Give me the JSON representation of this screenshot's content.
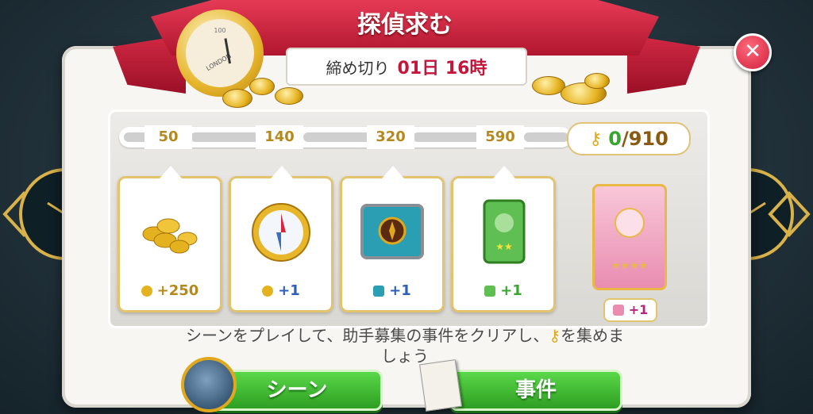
{
  "header": {
    "title": "探偵求む",
    "deadline_label": "締め切り",
    "deadline_value": "01日 16時",
    "stopwatch_text": "LONDON",
    "stopwatch_number": "100",
    "close_label": "✕"
  },
  "progress": {
    "milestones": [
      "50",
      "140",
      "320",
      "590"
    ],
    "current": "0",
    "total": "/910"
  },
  "rewards": [
    {
      "amount": "+250",
      "type": "coins"
    },
    {
      "amount": "+1",
      "type": "compass"
    },
    {
      "amount": "+1",
      "type": "chest"
    },
    {
      "amount": "+1",
      "type": "green-card"
    }
  ],
  "final_reward": {
    "amount": "+1",
    "type": "pink-card"
  },
  "instruction": {
    "line1": "シーンをプレイして、助手募集の事件をクリアし、",
    "line1b": "を集めま",
    "line2": "しょう"
  },
  "buttons": {
    "scene": "シーン",
    "case": "事件"
  },
  "colors": {
    "ribbon": "#c81f3b",
    "gold": "#e0a81c",
    "button_green": "#3fb530",
    "deadline_red": "#c4153a"
  }
}
